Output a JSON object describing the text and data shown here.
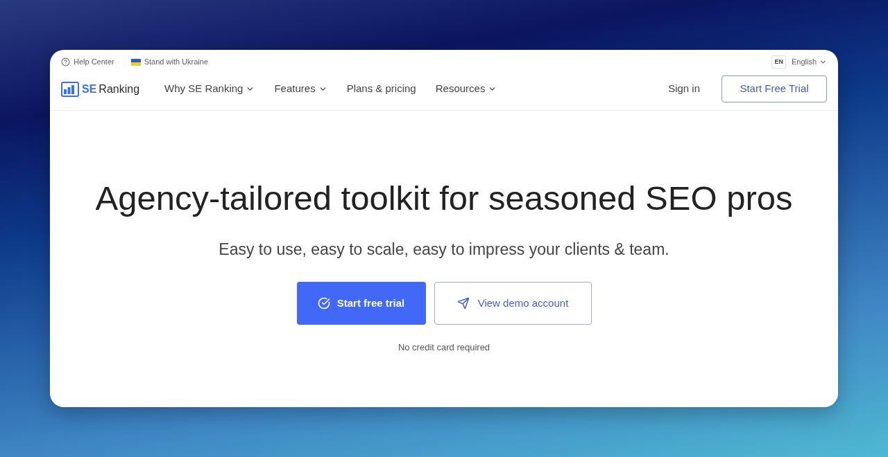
{
  "top_bar": {
    "links": [
      {
        "kind": "help",
        "label": "Help Center"
      },
      {
        "kind": "flag",
        "label": "Stand with Ukraine"
      }
    ],
    "language": {
      "code": "EN",
      "label": "English"
    }
  },
  "nav": {
    "logo": {
      "part_1": "SE",
      "part_2": "Ranking"
    },
    "items": [
      {
        "label": "Why SE Ranking",
        "dropdown": true
      },
      {
        "label": "Features",
        "dropdown": true
      },
      {
        "label": "Plans & pricing",
        "dropdown": false
      },
      {
        "label": "Resources",
        "dropdown": true
      }
    ],
    "sign_in": "Sign in",
    "cta": "Start Free Trial"
  },
  "hero": {
    "title": "Agency-tailored toolkit for seasoned SEO pros",
    "subtitle": "Easy to use, easy to scale, easy to impress your clients & team.",
    "buttons": [
      {
        "kind": "primary",
        "label": "Start free trial"
      },
      {
        "kind": "secondary",
        "label": "View demo account"
      }
    ],
    "note": "No credit card required"
  }
}
